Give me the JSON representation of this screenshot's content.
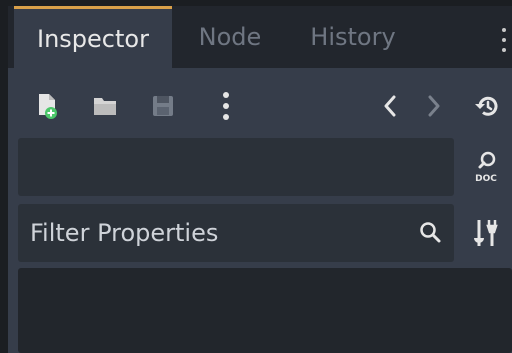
{
  "tabs": [
    {
      "label": "Inspector",
      "active": true
    },
    {
      "label": "Node",
      "active": false
    },
    {
      "label": "History",
      "active": false
    }
  ],
  "toolbar": {
    "icons": [
      "new-resource-icon",
      "open-folder-icon",
      "save-icon",
      "more-vertical-icon",
      "back-icon",
      "forward-icon",
      "history-icon"
    ]
  },
  "doc": {
    "icon": "search-doc-icon",
    "label": "DOC"
  },
  "filter": {
    "placeholder": "Filter Properties",
    "icon": "search-icon"
  },
  "tools_icon": "object-tools-icon",
  "colors": {
    "accent": "#d9a04a",
    "panel": "#363d4a",
    "field": "#2b3139",
    "tabbar": "#22262d"
  }
}
